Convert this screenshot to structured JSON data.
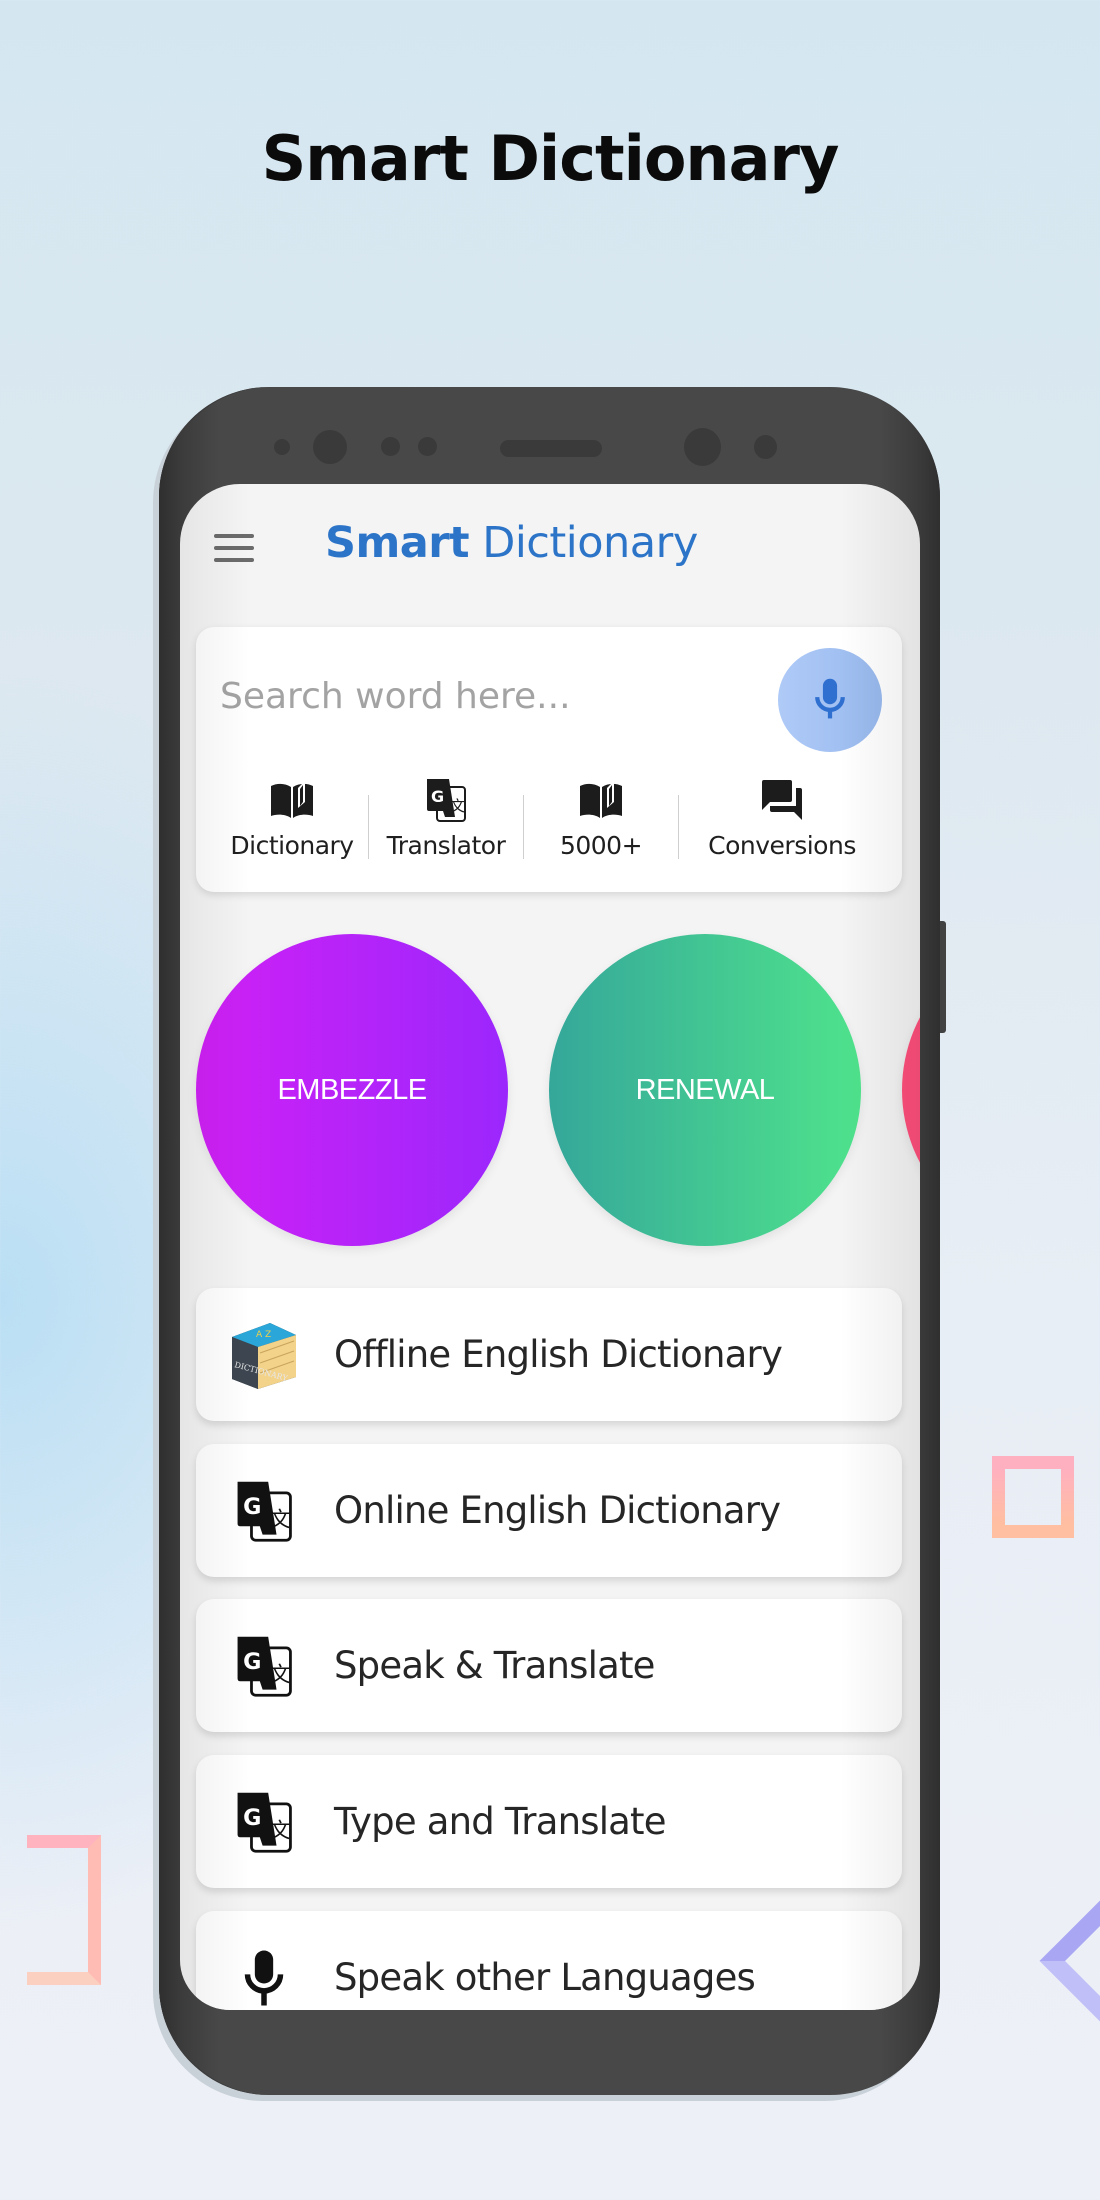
{
  "hero": {
    "title": "Smart Dictionary"
  },
  "app": {
    "title_bold": "Smart",
    "title_regular": "Dictionary",
    "menu_icon": "hamburger-menu-icon"
  },
  "search": {
    "placeholder": "Search word here...",
    "value": "",
    "voice_icon": "microphone-icon"
  },
  "quick_actions": [
    {
      "label": "Dictionary",
      "icon": "open-book-icon"
    },
    {
      "label": "Translator",
      "icon": "google-translate-icon"
    },
    {
      "label": "5000+",
      "icon": "open-book-icon"
    },
    {
      "label": "Conversions",
      "icon": "chat-bubbles-icon"
    }
  ],
  "words": [
    {
      "word": "EMBEZZLE",
      "gradient": [
        "#d020f5",
        "#9b27fc"
      ]
    },
    {
      "word": "RENEWAL",
      "gradient": [
        "#35a79a",
        "#4fe38c"
      ]
    },
    {
      "word": "",
      "gradient": [
        "#ff4f7b",
        "#f05a80"
      ]
    }
  ],
  "menu": [
    {
      "label": "Offline English Dictionary",
      "icon": "dictionary-book-icon"
    },
    {
      "label": "Online English Dictionary",
      "icon": "google-translate-icon"
    },
    {
      "label": "Speak & Translate",
      "icon": "google-translate-icon"
    },
    {
      "label": "Type and Translate",
      "icon": "google-translate-icon"
    },
    {
      "label": "Speak other Languages",
      "icon": "microphone-icon"
    }
  ],
  "colors": {
    "brand_blue": "#2c74c8",
    "mic_button": "#a8c4f5",
    "phone_body": "#484848"
  }
}
